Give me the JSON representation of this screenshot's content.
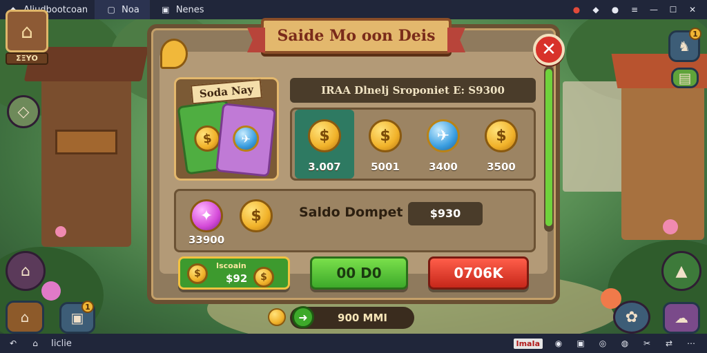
{
  "titlebar": {
    "app_name": "Aliudbootcoan",
    "tabs": [
      {
        "label": "Noa",
        "active": true
      },
      {
        "label": "Nenes",
        "active": false
      }
    ]
  },
  "hud": {
    "portrait_value": "ΣΞΥΟ",
    "left_badge_count": "1",
    "right_top_badge": "1"
  },
  "dialog": {
    "title": "Saide Mo oon Deis",
    "card_label": "Soda Nay",
    "info_bar": "IRAA Dlnelj Sroponiet E: S9300",
    "coins": [
      {
        "value": "3.007",
        "kind": "gold",
        "selected": true
      },
      {
        "value": "5001",
        "kind": "gold",
        "selected": false
      },
      {
        "value": "3400",
        "kind": "blue",
        "selected": false
      },
      {
        "value": "3500",
        "kind": "gold",
        "selected": false
      }
    ],
    "wallet": {
      "left_value": "33900",
      "label": "Saldo Dompet",
      "amount": "$930"
    },
    "buttons": {
      "coins_top": "Iscoain",
      "coins_amount": "$92",
      "green": "00 D0",
      "red": "0706K"
    }
  },
  "bottom": {
    "value": "900 MMI"
  },
  "taskbar": {
    "left_label": "Iiclie",
    "right_label": "ImaIa"
  },
  "colors": {
    "panel": "#8f7a5d",
    "green_button": "#3da92a",
    "red_button": "#c6271a",
    "close": "#d8322a"
  }
}
